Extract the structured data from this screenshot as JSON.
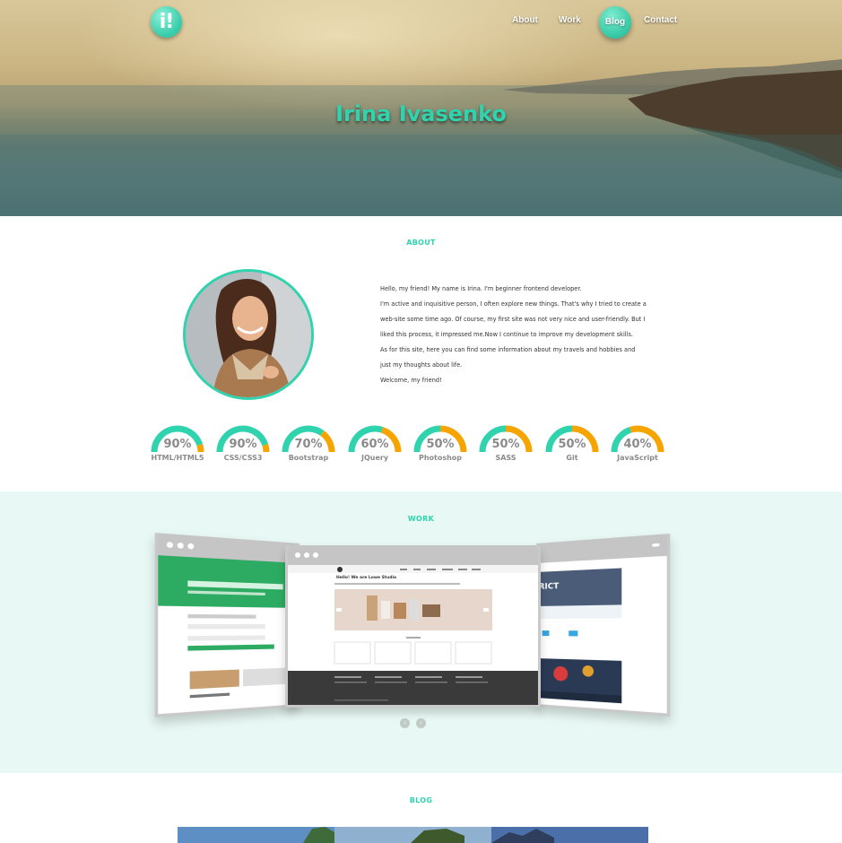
{
  "header": {
    "logo_text": "i!",
    "nav": [
      {
        "label": "About"
      },
      {
        "label": "Work"
      },
      {
        "label": "Blog",
        "active": true
      },
      {
        "label": "Contact"
      }
    ],
    "hero_title": "Irina Ivasenko"
  },
  "about": {
    "section_title": "ABOUT",
    "paragraph_lines": [
      "Hello, my friend! My name is Irina. I'm beginner frontend developer.",
      "I'm active and inquisitive person, I often explore new things. That's why I tried to create a",
      "web-site some time ago. Of course, my first site was not very nice and user-friendly. But I",
      "liked this process, it impressed me.Now I continue to improve my development skills.",
      "As for this site, here you can find some information about my travels and hobbies and",
      "just my thoughts about life.",
      "Welcome, my friend!"
    ],
    "skills": [
      {
        "label": "HTML/HTML5",
        "percent_text": "90%",
        "value": 90
      },
      {
        "label": "CSS/CSS3",
        "percent_text": "90%",
        "value": 90
      },
      {
        "label": "Bootstrap",
        "percent_text": "70%",
        "value": 70
      },
      {
        "label": "JQuery",
        "percent_text": "60%",
        "value": 60
      },
      {
        "label": "Photoshop",
        "percent_text": "50%",
        "value": 50
      },
      {
        "label": "SASS",
        "percent_text": "50%",
        "value": 50
      },
      {
        "label": "Git",
        "percent_text": "50%",
        "value": 50
      },
      {
        "label": "JavaScript",
        "percent_text": "40%",
        "value": 40
      }
    ]
  },
  "work": {
    "section_title": "WORK",
    "center_site_heading": "Hello! We are Lowe Studio",
    "right_site_heading": "RICT",
    "prev_glyph": "‹",
    "next_glyph": "›"
  },
  "blog": {
    "section_title": "BLOG"
  },
  "colors": {
    "accent": "#2fd3ad",
    "skill_track": "#f5a400",
    "work_bg": "#e8f8f4"
  }
}
